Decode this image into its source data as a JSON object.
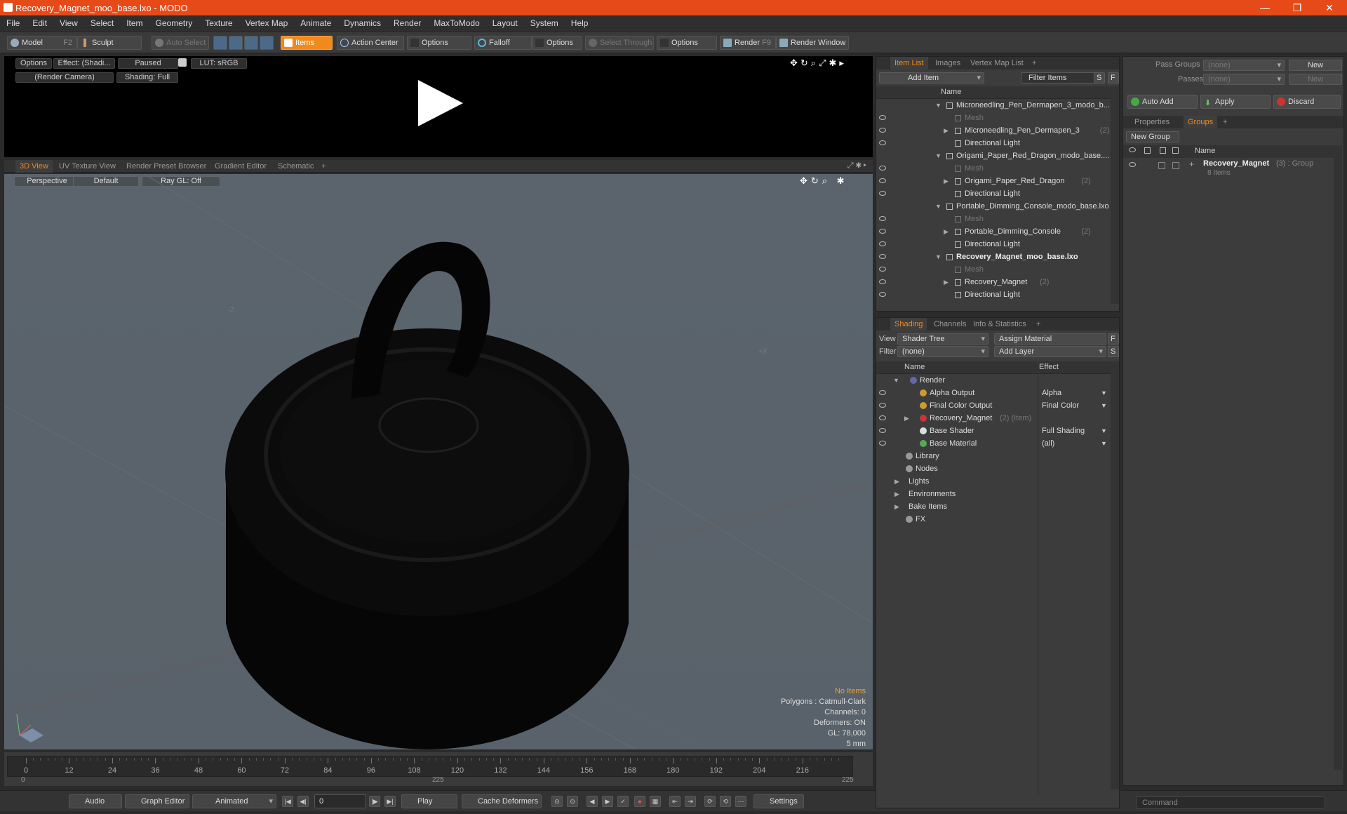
{
  "window": {
    "title": "Recovery_Magnet_moo_base.lxo - MODO"
  },
  "menu": [
    "File",
    "Edit",
    "View",
    "Select",
    "Item",
    "Geometry",
    "Texture",
    "Vertex Map",
    "Animate",
    "Dynamics",
    "Render",
    "MaxToModo",
    "Layout",
    "System",
    "Help"
  ],
  "toolbar": {
    "model": "Model",
    "model_key": "F2",
    "sculpt": "Sculpt",
    "auto_select": "Auto Select",
    "items": "Items",
    "action_center": "Action Center",
    "options1": "Options",
    "falloff": "Falloff",
    "options2": "Options",
    "select_through": "Select Through",
    "options3": "Options",
    "render": "Render",
    "render_key": "F9",
    "render_window": "Render Window"
  },
  "preview": {
    "options": "Options",
    "effect": "Effect: (Shadi...",
    "paused": "Paused",
    "lut": "LUT: sRGB",
    "camera": "(Render Camera)",
    "shading": "Shading: Full"
  },
  "viewport_tabs": [
    "3D View",
    "UV Texture View",
    "Render Preset Browser",
    "Gradient Editor",
    "Schematic",
    "+"
  ],
  "viewport": {
    "perspective": "Perspective",
    "default": "Default",
    "raygl": "Ray GL: Off",
    "axis_z": "-Z",
    "axis_x": "+X"
  },
  "stats": {
    "no_items": "No Items",
    "polygons": "Polygons : Catmull-Clark",
    "channels": "Channels: 0",
    "deformers": "Deformers: ON",
    "gl": "GL: 78,000",
    "size": "5 mm"
  },
  "timeline": {
    "labels": [
      "0",
      "12",
      "24",
      "36",
      "48",
      "60",
      "72",
      "84",
      "96",
      "108",
      "120",
      "132",
      "144",
      "156",
      "168",
      "180",
      "192",
      "204",
      "216"
    ],
    "start": "0",
    "mid": "225",
    "end": "225"
  },
  "bottombar": {
    "audio": "Audio",
    "graph_editor": "Graph Editor",
    "animated": "Animated",
    "frame": "0",
    "play": "Play",
    "cache": "Cache Deformers",
    "settings": "Settings"
  },
  "item_list": {
    "tabs": [
      "Item List",
      "Images",
      "Vertex Map List",
      "+"
    ],
    "add_item": "Add Item",
    "filter": "Filter Items",
    "s": "S",
    "f": "F",
    "col_name": "Name",
    "rows": [
      {
        "label": "Microneedling_Pen_Dermapen_3_modo_b...",
        "level": 0,
        "bold": false,
        "dim": false,
        "count": ""
      },
      {
        "label": "Mesh",
        "level": 1,
        "bold": false,
        "dim": true,
        "count": ""
      },
      {
        "label": "Microneedling_Pen_Dermapen_3",
        "level": 1,
        "bold": false,
        "dim": false,
        "count": "(2)"
      },
      {
        "label": "Directional Light",
        "level": 1,
        "bold": false,
        "dim": false,
        "count": ""
      },
      {
        "label": "Origami_Paper_Red_Dragon_modo_base....",
        "level": 0,
        "bold": false,
        "dim": false,
        "count": ""
      },
      {
        "label": "Mesh",
        "level": 1,
        "bold": false,
        "dim": true,
        "count": ""
      },
      {
        "label": "Origami_Paper_Red_Dragon",
        "level": 1,
        "bold": false,
        "dim": false,
        "count": "(2)"
      },
      {
        "label": "Directional Light",
        "level": 1,
        "bold": false,
        "dim": false,
        "count": ""
      },
      {
        "label": "Portable_Dimming_Console_modo_base.lxo",
        "level": 0,
        "bold": false,
        "dim": false,
        "count": ""
      },
      {
        "label": "Mesh",
        "level": 1,
        "bold": false,
        "dim": true,
        "count": ""
      },
      {
        "label": "Portable_Dimming_Console",
        "level": 1,
        "bold": false,
        "dim": false,
        "count": "(2)"
      },
      {
        "label": "Directional Light",
        "level": 1,
        "bold": false,
        "dim": false,
        "count": ""
      },
      {
        "label": "Recovery_Magnet_moo_base.lxo",
        "level": 0,
        "bold": true,
        "dim": false,
        "count": ""
      },
      {
        "label": "Mesh",
        "level": 1,
        "bold": false,
        "dim": true,
        "count": ""
      },
      {
        "label": "Recovery_Magnet",
        "level": 1,
        "bold": false,
        "dim": false,
        "count": "(2)"
      },
      {
        "label": "Directional Light",
        "level": 1,
        "bold": false,
        "dim": false,
        "count": ""
      }
    ]
  },
  "shading": {
    "tabs": [
      "Shading",
      "Channels",
      "Info & Statistics",
      "+"
    ],
    "view_label": "View",
    "view_value": "Shader Tree",
    "assign": "Assign Material",
    "f": "F",
    "filter_label": "Filter",
    "filter_value": "(none)",
    "add_layer": "Add Layer",
    "s": "S",
    "col_name": "Name",
    "col_effect": "Effect",
    "rows": [
      {
        "label": "Render",
        "effect": "",
        "level": 0,
        "extra": ""
      },
      {
        "label": "Alpha Output",
        "effect": "Alpha",
        "level": 1,
        "extra": ""
      },
      {
        "label": "Final Color Output",
        "effect": "Final Color",
        "level": 1,
        "extra": ""
      },
      {
        "label": "Recovery_Magnet",
        "effect": "",
        "level": 1,
        "extra": "(2) (Item)"
      },
      {
        "label": "Base Shader",
        "effect": "Full Shading",
        "level": 1,
        "extra": ""
      },
      {
        "label": "Base Material",
        "effect": "(all)",
        "level": 1,
        "extra": ""
      },
      {
        "label": "Library",
        "effect": "",
        "level": 0,
        "extra": ""
      },
      {
        "label": "Nodes",
        "effect": "",
        "level": 0,
        "extra": ""
      },
      {
        "label": "Lights",
        "effect": "",
        "level": -1,
        "extra": ""
      },
      {
        "label": "Environments",
        "effect": "",
        "level": -1,
        "extra": ""
      },
      {
        "label": "Bake Items",
        "effect": "",
        "level": -1,
        "extra": ""
      },
      {
        "label": "FX",
        "effect": "",
        "level": 0,
        "extra": ""
      }
    ]
  },
  "groups": {
    "pass_groups": "Pass Groups",
    "pass_groups_value": "(none)",
    "new": "New",
    "passes": "Passes",
    "passes_value": "(none)",
    "new2": "New",
    "auto_add": "Auto Add",
    "apply": "Apply",
    "discard": "Discard",
    "tabs": [
      "Properties",
      "Groups",
      "+"
    ],
    "new_group": "New Group",
    "col_name": "Name",
    "group_name": "Recovery_Magnet",
    "group_count": "(3) : Group",
    "group_items": "8 Items"
  },
  "command": {
    "placeholder": "Command"
  },
  "colors": {
    "accent": "#f08a1c",
    "title_bar": "#e64a19"
  }
}
